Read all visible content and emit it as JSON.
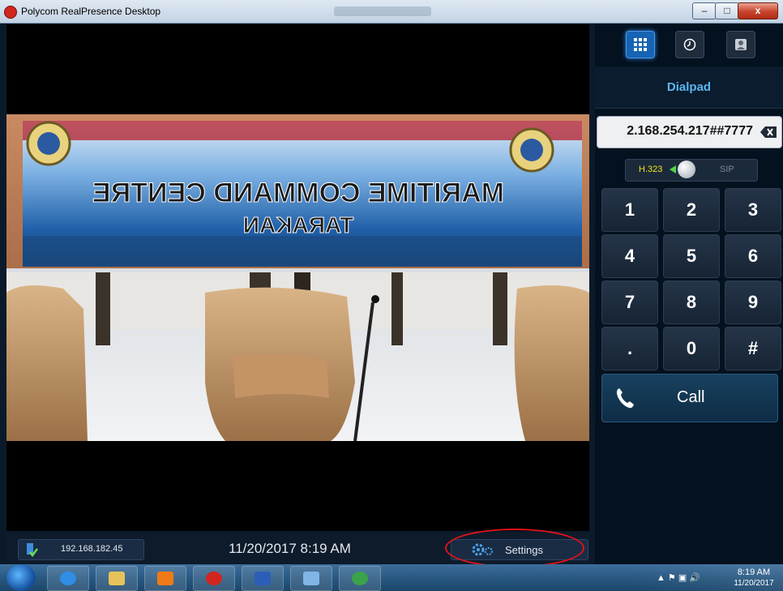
{
  "window": {
    "title": "Polycom RealPresence Desktop",
    "minimize_glyph": "–",
    "maximize_glyph": "□",
    "close_glyph": "x"
  },
  "video": {
    "banner_line1": "MARITIME COMMAND CENTRE",
    "banner_line2": "TARAKAN"
  },
  "statusbar": {
    "ip_address": "192.168.182.45",
    "datetime": "11/20/2017 8:19 AM",
    "settings_label": "Settings"
  },
  "right_panel": {
    "top_icons": [
      "dialpad-icon",
      "clock-icon",
      "contacts-icon"
    ],
    "header": "Dialpad",
    "dial_value": "2.168.254.217##7777",
    "protocol_left": "H.323",
    "protocol_right": "SIP",
    "keys": [
      "1",
      "2",
      "3",
      "4",
      "5",
      "6",
      "7",
      "8",
      "9",
      ".",
      "0",
      "#"
    ],
    "call_label": "Call"
  },
  "taskbar": {
    "apps": [
      "ie-icon",
      "explorer-icon",
      "outlook-icon",
      "polycom-icon",
      "word-icon",
      "control-panel-icon",
      "network-icon"
    ],
    "tray_time": "8:19 AM",
    "tray_date": "11/20/2017"
  },
  "colors": {
    "accent": "#5ab8f0",
    "highlight_ring": "#e2121a",
    "protocol_active": "#f1e219"
  }
}
